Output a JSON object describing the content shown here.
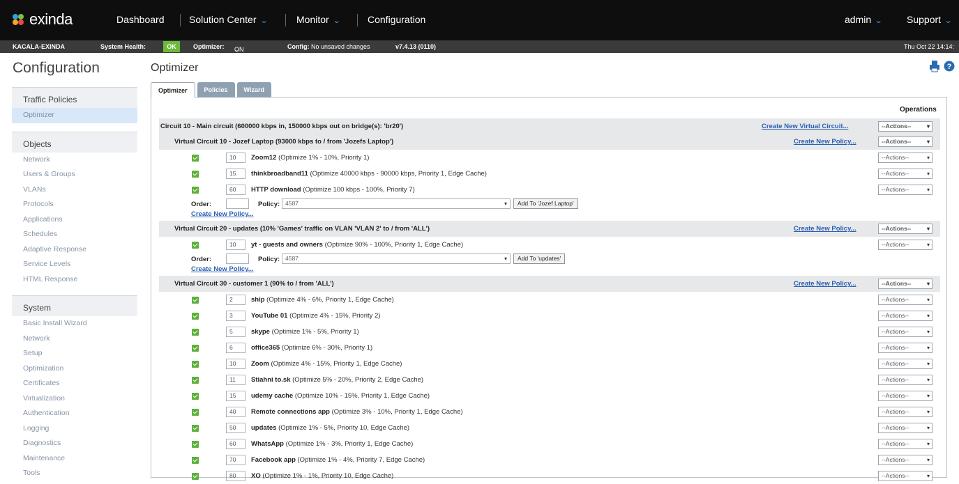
{
  "topnav": {
    "brand": "exinda",
    "links": [
      "Dashboard",
      "Solution Center",
      "Monitor",
      "Configuration"
    ],
    "user": "admin",
    "support": "Support"
  },
  "status": {
    "device": "KACALA-EXINDA",
    "health_label": "System Health:",
    "health_value": "OK",
    "optimizer_label": "Optimizer:",
    "optimizer_value": "ON",
    "config_label": "Config:",
    "config_value": "No unsaved changes",
    "version": "v7.4.13 (0110)",
    "datetime": "Thu Oct 22 14:14:"
  },
  "header": {
    "section": "Configuration",
    "page": "Optimizer"
  },
  "sidebar": {
    "groups": [
      {
        "title": "Traffic Policies",
        "items": [
          "Optimizer"
        ]
      },
      {
        "title": "Objects",
        "items": [
          "Network",
          "Users & Groups",
          "VLANs",
          "Protocols",
          "Applications",
          "Schedules",
          "Adaptive Response",
          "Service Levels",
          "HTML Response"
        ]
      },
      {
        "title": "System",
        "items": [
          "Basic Install Wizard",
          "Network",
          "Setup",
          "Optimization",
          "Certificates",
          "Virtualization",
          "Authentication",
          "Logging",
          "Diagnostics",
          "Maintenance",
          "Tools"
        ]
      }
    ]
  },
  "tabs": [
    "Optimizer",
    "Policies",
    "Wizard"
  ],
  "ops_header": "Operations",
  "actions_label": "--Actions--",
  "circuit": {
    "label": "Circuit 10 - Main circuit (600000 kbps in, 150000 kbps out on bridge(s): 'br20')",
    "create": "Create New Virtual Circuit..."
  },
  "vcs": [
    {
      "label": "Virtual Circuit 10 - Jozef Laptop (93000 kbps to / from 'Jozefs Laptop')",
      "create": "Create New Policy...",
      "policies": [
        {
          "order": "10",
          "name": "Zoom12",
          "detail": " (Optimize 1% - 10%, Priority 1)"
        },
        {
          "order": "15",
          "name": "thinkbroadband11",
          "detail": " (Optimize 40000 kbps - 90000 kbps, Priority 1, Edge Cache)"
        },
        {
          "order": "60",
          "name": "HTTP download",
          "detail": " (Optimize 100 kbps - 100%, Priority 7)"
        }
      ],
      "order_label": "Order:",
      "policy_label": "Policy:",
      "policy_value": "4587",
      "add_button": "Add To 'Jozef Laptop'",
      "create_link": "Create New Policy..."
    },
    {
      "label": "Virtual Circuit 20 - updates (10% 'Games' traffic on VLAN 'VLAN 2' to / from 'ALL')",
      "create": "Create New Policy...",
      "policies": [
        {
          "order": "10",
          "name": "yt - guests and owners",
          "detail": " (Optimize 90% - 100%, Priority 1, Edge Cache)"
        }
      ],
      "order_label": "Order:",
      "policy_label": "Policy:",
      "policy_value": "4587",
      "add_button": "Add To 'updates'",
      "create_link": "Create New Policy..."
    },
    {
      "label": "Virtual Circuit 30 - customer 1 (90% to / from 'ALL')",
      "create": "Create New Policy...",
      "policies": [
        {
          "order": "2",
          "name": "ship",
          "detail": " (Optimize 4% - 6%, Priority 1, Edge Cache)"
        },
        {
          "order": "3",
          "name": "YouTube 01",
          "detail": " (Optimize 4% - 15%, Priority 2)"
        },
        {
          "order": "5",
          "name": "skype",
          "detail": " (Optimize 1% - 5%, Priority 1)"
        },
        {
          "order": "6",
          "name": "office365",
          "detail": " (Optimize 6% - 30%, Priority 1)"
        },
        {
          "order": "10",
          "name": "Zoom",
          "detail": " (Optimize 4% - 15%, Priority 1, Edge Cache)"
        },
        {
          "order": "11",
          "name": "Stiahni to.sk",
          "detail": " (Optimize 5% - 20%, Priority 2, Edge Cache)"
        },
        {
          "order": "15",
          "name": "udemy cache",
          "detail": " (Optimize 10% - 15%, Priority 1, Edge Cache)"
        },
        {
          "order": "40",
          "name": "Remote connections app",
          "detail": " (Optimize 3% - 10%, Priority 1, Edge Cache)"
        },
        {
          "order": "50",
          "name": "updates",
          "detail": " (Optimize 1% - 5%, Priority 10, Edge Cache)"
        },
        {
          "order": "60",
          "name": "WhatsApp",
          "detail": " (Optimize 1% - 3%, Priority 1, Edge Cache)"
        },
        {
          "order": "70",
          "name": "Facebook app",
          "detail": " (Optimize 1% - 4%, Priority 7, Edge Cache)"
        },
        {
          "order": "80",
          "name": "XO",
          "detail": " (Optimize 1% - 1%, Priority 10, Edge Cache)"
        }
      ]
    }
  ],
  "colors": {
    "status_ok": "#6cba3a",
    "link": "#2b5fb4",
    "accent": "#3ea1ff"
  }
}
